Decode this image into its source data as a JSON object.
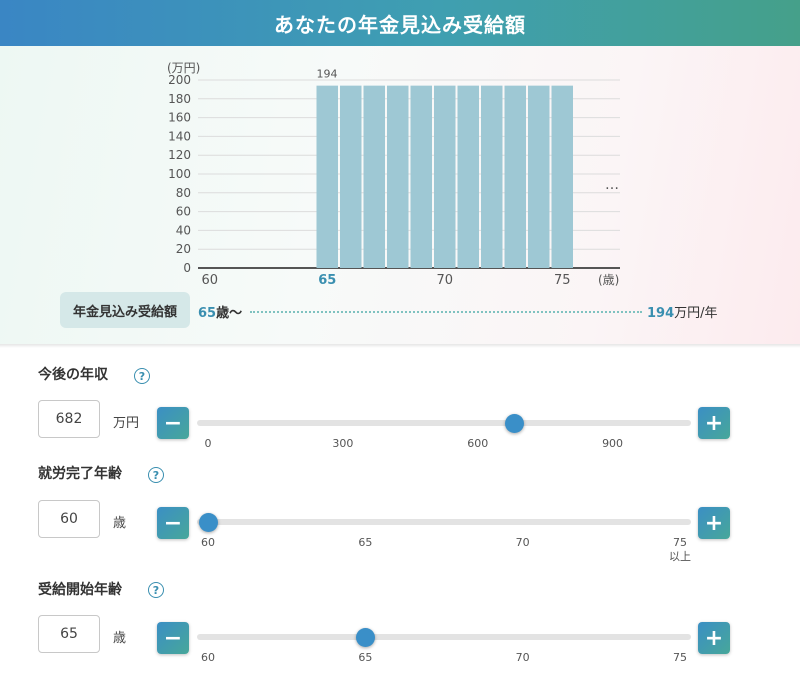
{
  "header": {
    "title": "あなたの年金見込み受給額"
  },
  "chart_data": {
    "type": "bar",
    "y_unit": "(万円)",
    "x_unit": "(歳)",
    "ylim": [
      0,
      200
    ],
    "y_ticks": [
      0,
      20,
      40,
      60,
      80,
      100,
      120,
      140,
      160,
      180,
      200
    ],
    "x_tick_labels": [
      {
        "age": 60,
        "label": "60",
        "highlight": false
      },
      {
        "age": 65,
        "label": "65",
        "highlight": true
      },
      {
        "age": 70,
        "label": "70",
        "highlight": false
      },
      {
        "age": 75,
        "label": "75",
        "highlight": false
      }
    ],
    "categories": [
      60,
      61,
      62,
      63,
      64,
      65,
      66,
      67,
      68,
      69,
      70,
      71,
      72,
      73,
      74,
      75
    ],
    "values": [
      0,
      0,
      0,
      0,
      0,
      194,
      194,
      194,
      194,
      194,
      194,
      194,
      194,
      194,
      194,
      194
    ],
    "data_label": "194",
    "continuation": "…",
    "bar_color": "#9ec8d4",
    "grid": true
  },
  "summary": {
    "label": "年金見込み受給額",
    "start_age": "65",
    "start_suffix": "歳〜",
    "amount": "194",
    "amount_unit": "万円/年"
  },
  "settings": {
    "income": {
      "label": "今後の年収",
      "help": "?",
      "value": "682",
      "unit": "万円",
      "min": 0,
      "max": 1050,
      "current": 682,
      "ticks": [
        {
          "value": 0,
          "label": "0"
        },
        {
          "value": 300,
          "label": "300"
        },
        {
          "value": 600,
          "label": "600"
        },
        {
          "value": 900,
          "label": "900"
        }
      ],
      "minus": "−",
      "plus": "+"
    },
    "work_end_age": {
      "label": "就労完了年齢",
      "help": "?",
      "value": "60",
      "unit": "歳",
      "min": 60,
      "max": 75,
      "current": 60,
      "ticks": [
        {
          "value": 60,
          "label": "60"
        },
        {
          "value": 65,
          "label": "65"
        },
        {
          "value": 70,
          "label": "70"
        },
        {
          "value": 75,
          "label": "75",
          "sub": "以上"
        }
      ],
      "minus": "−",
      "plus": "+"
    },
    "pension_start_age": {
      "label": "受給開始年齢",
      "help": "?",
      "value": "65",
      "unit": "歳",
      "min": 60,
      "max": 75,
      "current": 65,
      "ticks": [
        {
          "value": 60,
          "label": "60"
        },
        {
          "value": 65,
          "label": "65"
        },
        {
          "value": 70,
          "label": "70"
        },
        {
          "value": 75,
          "label": "75"
        }
      ],
      "minus": "−",
      "plus": "+"
    }
  }
}
